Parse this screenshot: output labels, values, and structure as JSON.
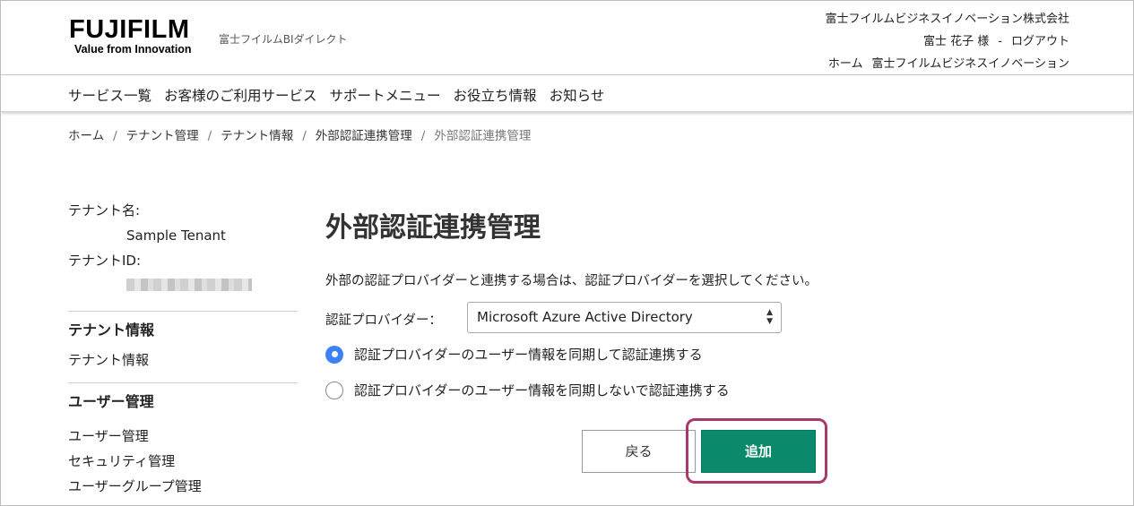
{
  "header": {
    "logo_main": "FUJIFILM",
    "logo_tagline": "Value from Innovation",
    "sub_brand": "富士フイルムBIダイレクト",
    "company": "富士フイルムビジネスイノベーション株式会社",
    "user_name": "富士 花子 様",
    "separator": "-",
    "logout": "ログアウト",
    "home": "ホーム",
    "company_link": "富士フイルムビジネスイノベーション"
  },
  "nav": {
    "items": [
      "サービス一覧",
      "お客様のご利用サービス",
      "サポートメニュー",
      "お役立ち情報",
      "お知らせ"
    ]
  },
  "breadcrumb": {
    "items": [
      "ホーム",
      "テナント管理",
      "テナント情報",
      "外部認証連携管理"
    ],
    "current": "外部認証連携管理",
    "separator": "/"
  },
  "sidebar": {
    "tenant_name_label": "テナント名:",
    "tenant_name_value": "Sample Tenant",
    "tenant_id_label": "テナントID:",
    "sections": [
      {
        "heading": "テナント情報",
        "links": [
          "テナント情報"
        ]
      },
      {
        "heading": "ユーザー管理",
        "links": [
          "ユーザー管理",
          "セキュリティ管理",
          "ユーザーグループ管理"
        ]
      }
    ]
  },
  "main": {
    "title": "外部認証連携管理",
    "description": "外部の認証プロバイダーと連携する場合は、認証プロバイダーを選択してください。",
    "provider_label": "認証プロバイダー：",
    "provider_selected": "Microsoft Azure Active Directory",
    "radio_options": [
      {
        "label": "認証プロバイダーのユーザー情報を同期して認証連携する",
        "checked": true
      },
      {
        "label": "認証プロバイダーのユーザー情報を同期しないで認証連携する",
        "checked": false
      }
    ],
    "back_button": "戻る",
    "add_button": "追加"
  },
  "colors": {
    "accent_green": "#0a8a6a",
    "radio_blue": "#3b82f6",
    "highlight": "#a8396b"
  },
  "icons": {
    "select_arrows": "up-down-arrows-icon"
  }
}
